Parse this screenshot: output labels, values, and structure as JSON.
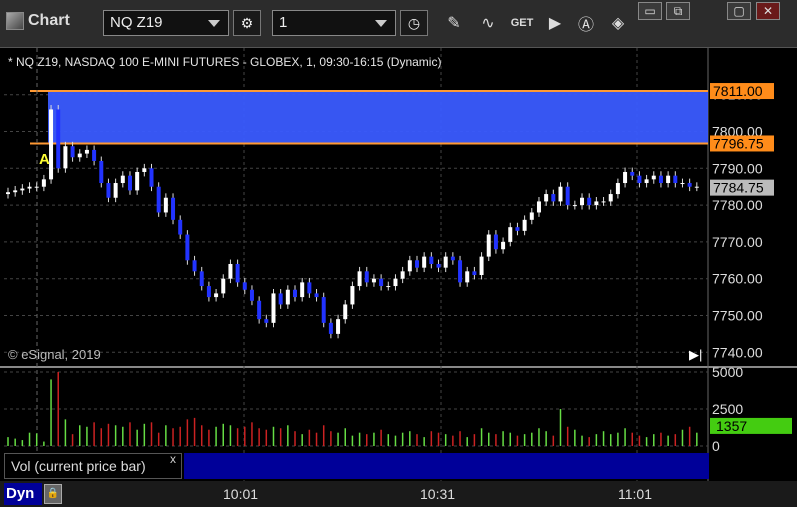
{
  "window": {
    "title": "Chart",
    "minimize": "▭",
    "restore": "⧉",
    "close": "✕"
  },
  "toolbar": {
    "symbol": "NQ Z19",
    "interval": "1",
    "icons": [
      "gear-icon",
      "clock-icon",
      "pencil-icon",
      "study-icon",
      "get-icon",
      "play-icon",
      "alert-icon",
      "diamond-icon"
    ]
  },
  "chart": {
    "header": "* NQ Z19, NASDAQ 100 E-MINI FUTURES - GLOBEX, 1, 09:30-16:15 (Dynamic)",
    "copyright": "© eSignal, 2019",
    "marker": "A",
    "price_labels": {
      "upper": "7811.00",
      "lower": "7796.75",
      "last": "7784.75",
      "volume": "1357"
    },
    "x_ticks": [
      "10:01",
      "10:31",
      "11:01"
    ],
    "vol_ticks": [
      "5000",
      "2500",
      "0"
    ],
    "vol_label": "Vol (current price bar)",
    "vol_close": "x",
    "dyn": "Dyn"
  },
  "chart_data": {
    "type": "candlestick",
    "title": "NQ Z19, NASDAQ 100 E-MINI FUTURES - GLOBEX, 1, 09:30-16:15 (Dynamic)",
    "y_ticks": [
      "7740.00",
      "7750.00",
      "7760.00",
      "7770.00",
      "7780.00",
      "7790.00",
      "7800.00",
      "7810.00"
    ],
    "ylim": [
      7736,
      7814
    ],
    "x_ticks": [
      "10:01",
      "10:31",
      "11:01"
    ],
    "zone": {
      "from": 7796.75,
      "to": 7811.0,
      "color": "#3a5bff"
    },
    "last_price": 7784.75,
    "closes": [
      7783.5,
      7784,
      7784.5,
      7785,
      7785,
      7787,
      7806,
      7790,
      7796,
      7793,
      7794,
      7795,
      7792,
      7786,
      7782,
      7786,
      7788,
      7784,
      7789,
      7790,
      7785,
      7778,
      7782,
      7776,
      7772,
      7765,
      7762,
      7758,
      7755,
      7756,
      7760,
      7764,
      7759,
      7757,
      7754,
      7749,
      7748,
      7756,
      7753,
      7757,
      7755,
      7759,
      7756,
      7755,
      7748,
      7745,
      7749,
      7753,
      7758,
      7762,
      7759,
      7760,
      7758,
      7758,
      7760,
      7762,
      7765,
      7763,
      7766,
      7764,
      7763,
      7766,
      7765,
      7759,
      7762,
      7761,
      7766,
      7772,
      7768,
      7770,
      7774,
      7773,
      7776,
      7778,
      7781,
      7783,
      7781,
      7785,
      7780,
      7780,
      7782,
      7780,
      7781,
      7781,
      7783,
      7786,
      7789,
      7788,
      7786,
      7787,
      7788,
      7786,
      7788,
      7786,
      7786,
      7785,
      7785
    ]
  },
  "volume_data": {
    "ylim": [
      0,
      5000
    ],
    "values": [
      600,
      500,
      400,
      900,
      850,
      300,
      4500,
      5000,
      1800,
      800,
      1400,
      1300,
      1600,
      1200,
      1500,
      1400,
      1300,
      1600,
      1100,
      1500,
      1600,
      900,
      1400,
      1200,
      1300,
      1800,
      1900,
      1400,
      1100,
      1300,
      1500,
      1400,
      1200,
      1300,
      1600,
      1200,
      1100,
      1300,
      1200,
      1400,
      1000,
      800,
      1100,
      900,
      1400,
      1000,
      900,
      1200,
      700,
      900,
      800,
      900,
      1100,
      800,
      700,
      900,
      1000,
      800,
      600,
      1000,
      900,
      800,
      700,
      1000,
      600,
      800,
      1200,
      900,
      800,
      1000,
      900,
      700,
      800,
      900,
      1200,
      1000,
      700,
      2500,
      1300,
      1100,
      700,
      600,
      800,
      1000,
      800,
      900,
      1200,
      900,
      700,
      600,
      800,
      900,
      700,
      800,
      1100,
      1300,
      900
    ],
    "up_color": "#66dd44",
    "down_color": "#cc2222"
  }
}
